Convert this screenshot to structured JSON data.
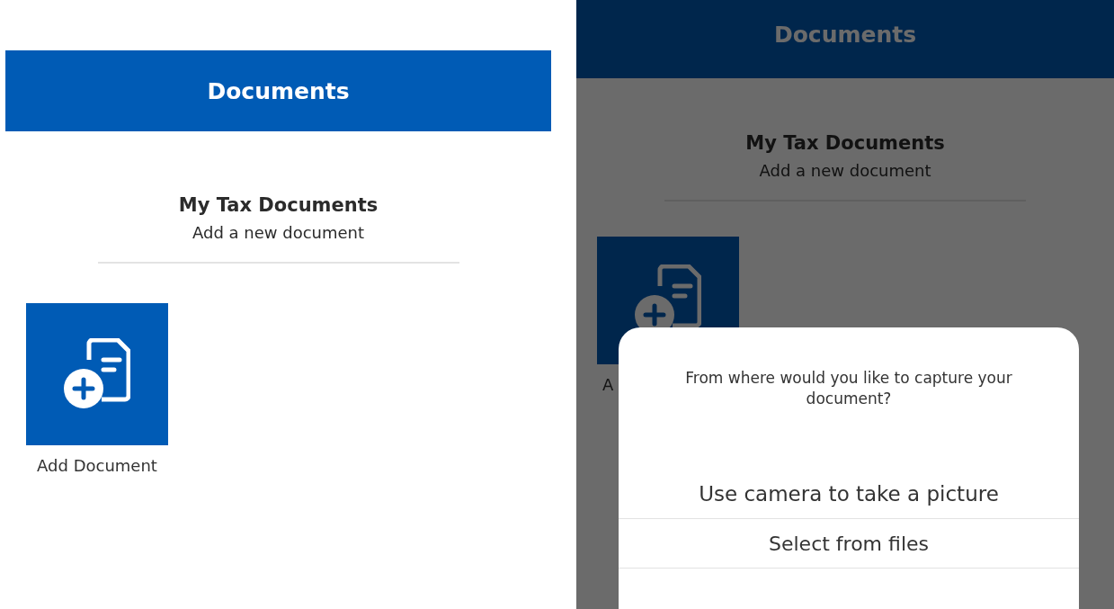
{
  "screens": [
    {
      "dimmed": false,
      "header": {
        "title": "Documents"
      },
      "section": {
        "title": "My Tax Documents",
        "subtitle": "Add a new document"
      },
      "tiles": [
        {
          "label": "Add Document"
        }
      ]
    },
    {
      "dimmed": true,
      "header": {
        "title": "Documents"
      },
      "section": {
        "title": "My Tax Documents",
        "subtitle": "Add a new document"
      },
      "tiles": [
        {
          "label": "A"
        }
      ],
      "sheet": {
        "prompt": "From where would you like to capture your document?",
        "options": [
          {
            "label": "Use camera to take a picture"
          },
          {
            "label": "Select from files"
          }
        ]
      }
    }
  ]
}
